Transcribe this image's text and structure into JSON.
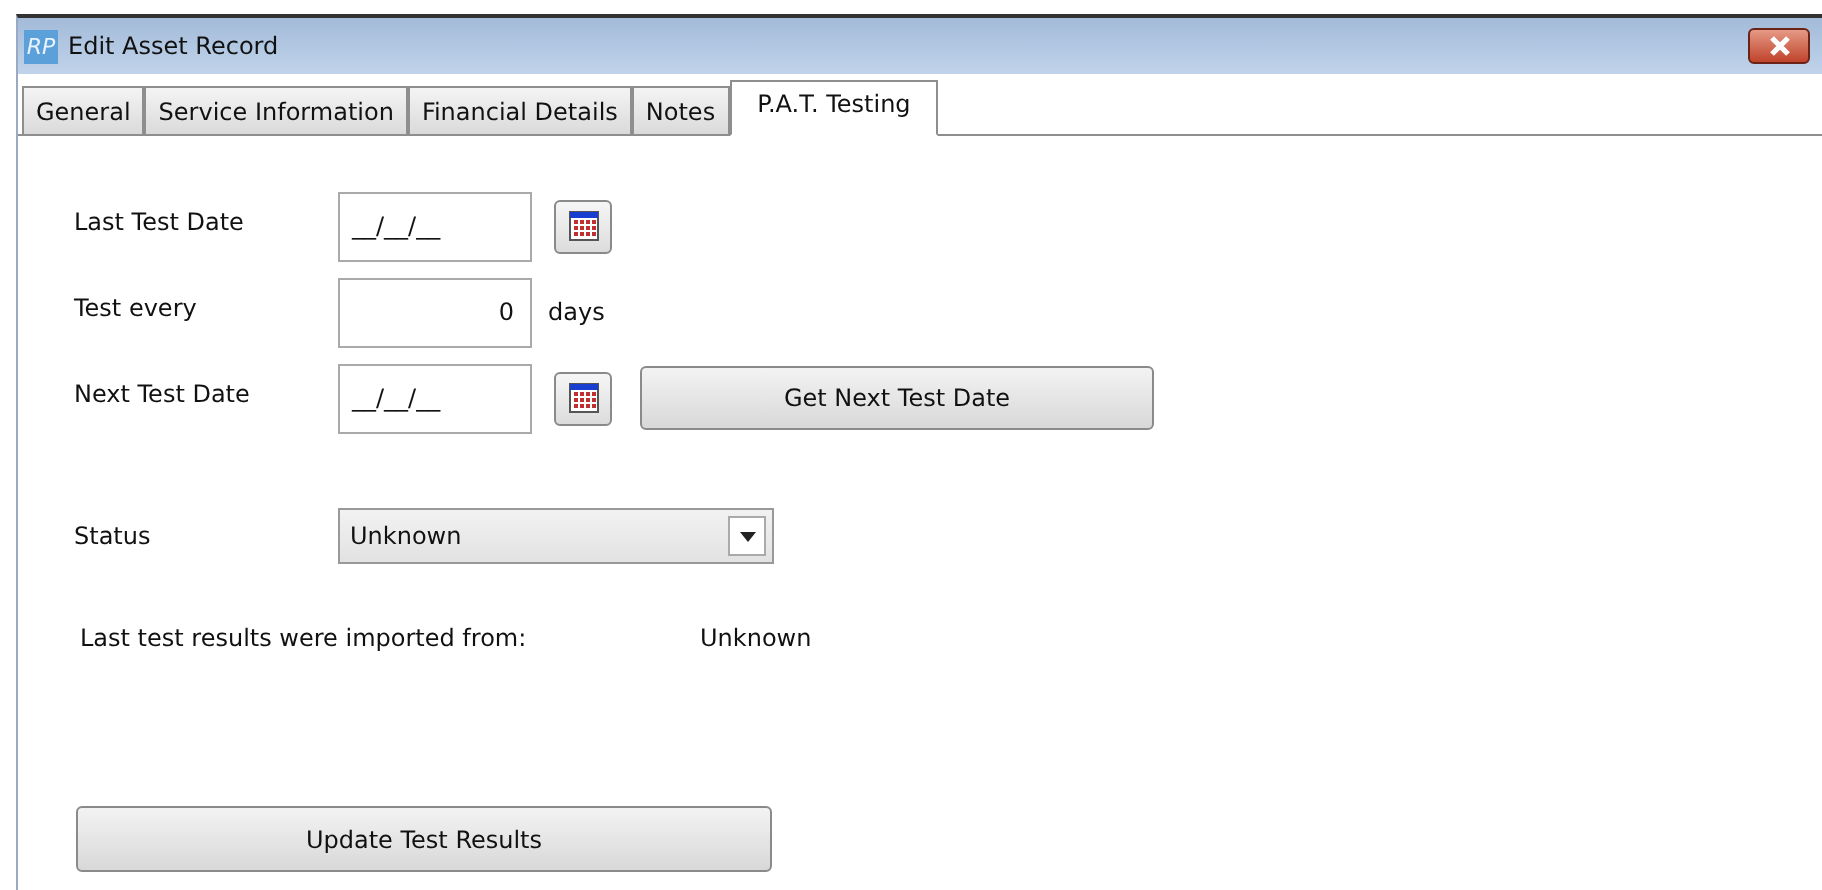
{
  "window": {
    "app_badge": "RP",
    "title": "Edit Asset Record"
  },
  "tabs": [
    {
      "label": "General",
      "selected": false
    },
    {
      "label": "Service Information",
      "selected": false
    },
    {
      "label": "Financial Details",
      "selected": false
    },
    {
      "label": "Notes",
      "selected": false
    },
    {
      "label": "P.A.T. Testing",
      "selected": true
    }
  ],
  "fields": [
    {
      "kind": "date",
      "label": "Last Test Date",
      "value": "__/__/__"
    },
    {
      "kind": "number",
      "label": "Test every",
      "value": "0",
      "unit": "days"
    },
    {
      "kind": "date",
      "label": "Next Test Date",
      "value": "__/__/__",
      "button": "Get Next Test Date"
    }
  ],
  "status": {
    "label": "Status",
    "value": "Unknown"
  },
  "import_info": {
    "label": "Last test results were imported from:",
    "value": "Unknown"
  },
  "update_button": "Update Test Results"
}
